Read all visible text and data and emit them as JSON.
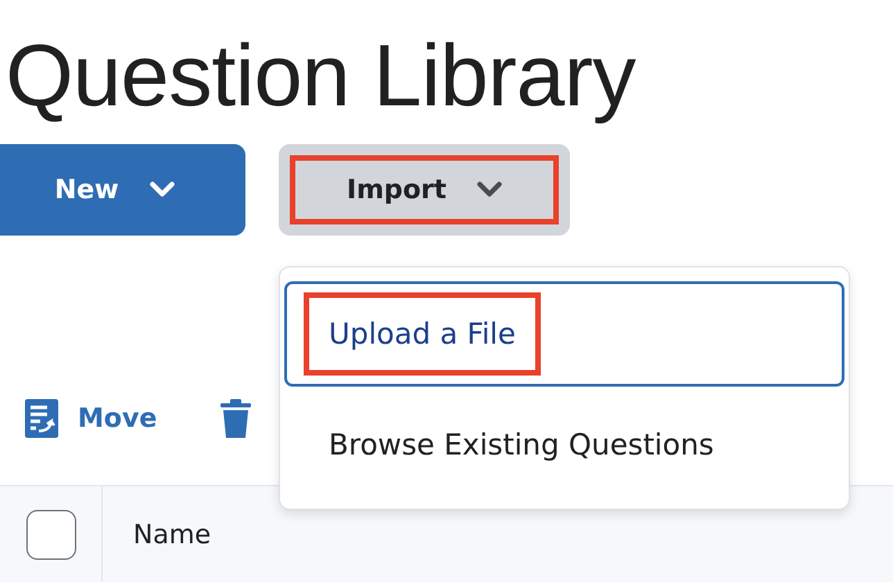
{
  "title": "Question Library",
  "buttons": [
    {
      "label": "New",
      "kind": "primary",
      "highlighted": false
    },
    {
      "label": "Import",
      "kind": "secondary",
      "highlighted": true
    }
  ],
  "toolbar": [
    {
      "label": "Move",
      "kind": "move"
    },
    {
      "kind": "delete"
    }
  ],
  "dropdown": {
    "items": [
      {
        "label": "Upload a File",
        "selected": true,
        "highlighted": true
      },
      {
        "label": "Browse Existing Questions",
        "selected": false,
        "highlighted": false
      }
    ]
  },
  "table": {
    "select_all": {
      "checked": false
    },
    "columns": [
      "Name"
    ]
  }
}
